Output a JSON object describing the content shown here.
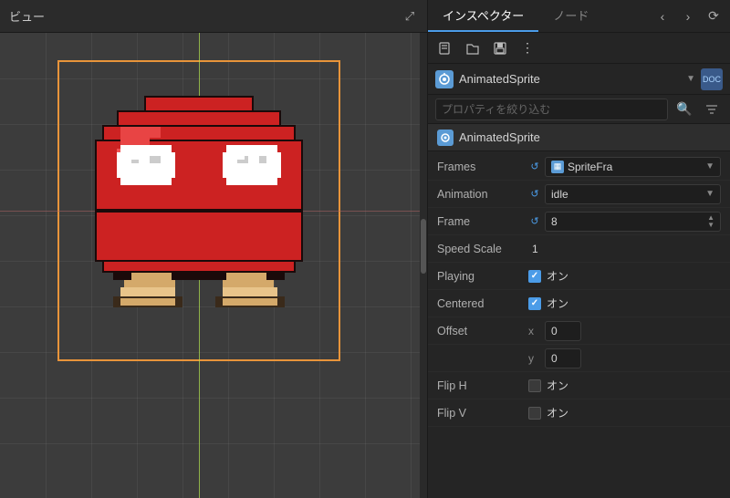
{
  "viewport": {
    "title": "ビュー",
    "expand_icon": "⤢"
  },
  "inspector": {
    "tab_inspector": "インスペクター",
    "tab_node": "ノード",
    "toolbar": {
      "new_icon": "📄",
      "open_icon": "📂",
      "save_icon": "💾",
      "more_icon": "⋮",
      "back_icon": "‹",
      "forward_icon": "›",
      "history_icon": "⟳"
    },
    "node_type": "AnimatedSprite",
    "doc_label": "DOC",
    "search_placeholder": "プロパティを絞り込む",
    "section_title": "AnimatedSprite",
    "properties": [
      {
        "label": "Frames",
        "type": "resource",
        "value": "SpriteFra",
        "has_reset": true
      },
      {
        "label": "Animation",
        "type": "dropdown",
        "value": "idle",
        "has_reset": true
      },
      {
        "label": "Frame",
        "type": "stepper",
        "value": "8",
        "has_reset": true
      },
      {
        "label": "Speed Scale",
        "type": "number",
        "value": "1",
        "has_reset": false
      },
      {
        "label": "Playing",
        "type": "checkbox",
        "value": "オン",
        "checked": true,
        "has_reset": false
      },
      {
        "label": "Centered",
        "type": "checkbox",
        "value": "オン",
        "checked": true,
        "has_reset": false
      },
      {
        "label": "Offset",
        "type": "xy",
        "x": "0",
        "y": "0",
        "has_reset": false
      },
      {
        "label": "Flip H",
        "type": "checkbox",
        "value": "オン",
        "checked": false,
        "has_reset": false
      },
      {
        "label": "Flip V",
        "type": "checkbox",
        "value": "オン",
        "checked": false,
        "has_reset": false
      }
    ]
  }
}
